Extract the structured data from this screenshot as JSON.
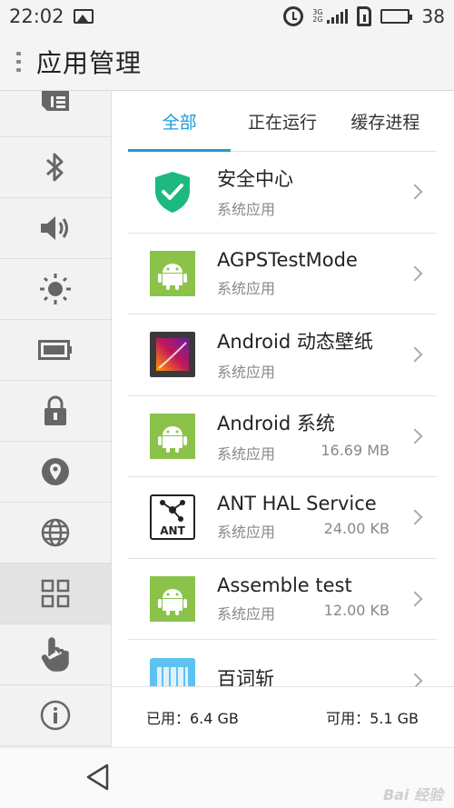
{
  "status_bar": {
    "time": "22:02",
    "net_top": "3G",
    "net_bottom": "2G",
    "battery": "38"
  },
  "app_bar": {
    "title": "应用管理"
  },
  "sidebar": {
    "items": [
      {
        "icon": "sim-card-icon"
      },
      {
        "icon": "bluetooth-icon"
      },
      {
        "icon": "volume-icon"
      },
      {
        "icon": "brightness-icon"
      },
      {
        "icon": "battery-icon"
      },
      {
        "icon": "lock-icon"
      },
      {
        "icon": "location-icon"
      },
      {
        "icon": "globe-icon"
      },
      {
        "icon": "apps-grid-icon",
        "active": true
      },
      {
        "icon": "hand-gesture-icon"
      },
      {
        "icon": "info-icon"
      }
    ]
  },
  "tabs": [
    {
      "label": "全部",
      "active": true
    },
    {
      "label": "正在运行"
    },
    {
      "label": "缓存进程"
    }
  ],
  "apps": [
    {
      "name": "安全中心",
      "type": "系统应用",
      "size": "",
      "icon": "security-shield-icon"
    },
    {
      "name": "AGPSTestMode",
      "type": "系统应用",
      "size": "",
      "icon": "android-icon"
    },
    {
      "name": "Android 动态壁纸",
      "type": "系统应用",
      "size": "",
      "icon": "live-wallpaper-icon"
    },
    {
      "name": "Android 系统",
      "type": "系统应用",
      "size": "16.69 MB",
      "icon": "android-icon"
    },
    {
      "name": "ANT HAL Service",
      "type": "系统应用",
      "size": "24.00 KB",
      "icon": "ant-icon"
    },
    {
      "name": "Assemble test",
      "type": "系统应用",
      "size": "12.00 KB",
      "icon": "android-icon"
    },
    {
      "name": "百词斩",
      "type": "",
      "size": "",
      "icon": "baicizhan-icon"
    }
  ],
  "storage": {
    "used": "已用：6.4 GB",
    "available": "可用：5.1 GB"
  },
  "colors": {
    "accent": "#1c9bd6",
    "android_green": "#8bc34a",
    "shield_green": "#1eb980"
  },
  "watermark": "Bai 经验"
}
